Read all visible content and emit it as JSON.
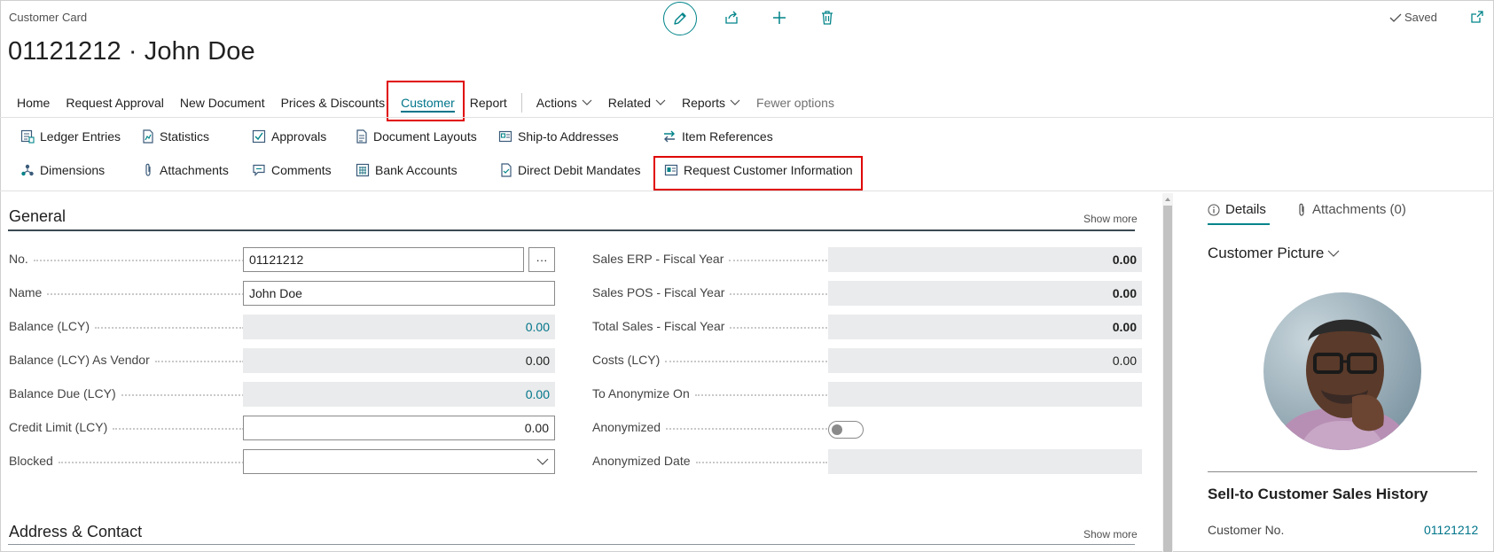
{
  "window": {
    "caption": "Customer Card",
    "title": "01121212 · John Doe",
    "status": "Saved"
  },
  "menu": {
    "items": [
      "Home",
      "Request Approval",
      "New Document",
      "Prices & Discounts",
      "Customer",
      "Report"
    ],
    "dropdowns": [
      "Actions",
      "Related",
      "Reports"
    ],
    "fewer_options": "Fewer options"
  },
  "actions": {
    "ledger_entries": "Ledger Entries",
    "statistics": "Statistics",
    "approvals": "Approvals",
    "document_layouts": "Document Layouts",
    "ship_to_addresses": "Ship-to Addresses",
    "item_references": "Item References",
    "dimensions": "Dimensions",
    "attachments": "Attachments",
    "comments": "Comments",
    "bank_accounts": "Bank Accounts",
    "direct_debit_mandates": "Direct Debit Mandates",
    "request_customer_information": "Request Customer Information"
  },
  "general": {
    "title": "General",
    "show_more": "Show more",
    "left_fields": [
      {
        "label": "No.",
        "value": "01121212"
      },
      {
        "label": "Name",
        "value": "John Doe"
      },
      {
        "label": "Balance (LCY)",
        "value": "0.00"
      },
      {
        "label": "Balance (LCY) As Vendor",
        "value": "0.00"
      },
      {
        "label": "Balance Due (LCY)",
        "value": "0.00"
      },
      {
        "label": "Credit Limit (LCY)",
        "value": "0.00"
      },
      {
        "label": "Blocked",
        "value": ""
      }
    ],
    "right_fields": [
      {
        "label": "Sales ERP - Fiscal Year",
        "value": "0.00"
      },
      {
        "label": "Sales POS - Fiscal Year",
        "value": "0.00"
      },
      {
        "label": "Total Sales - Fiscal Year",
        "value": "0.00"
      },
      {
        "label": "Costs (LCY)",
        "value": "0.00"
      },
      {
        "label": "To Anonymize On",
        "value": ""
      },
      {
        "label": "Anonymized",
        "value": "off"
      },
      {
        "label": "Anonymized Date",
        "value": ""
      }
    ],
    "more_button": "···"
  },
  "address": {
    "title": "Address & Contact",
    "show_more": "Show more"
  },
  "factbox": {
    "tab_details": "Details",
    "tab_attachments": "Attachments (0)",
    "customer_picture": "Customer Picture",
    "sales_history_title": "Sell-to Customer Sales History",
    "customer_no_label": "Customer No.",
    "customer_no_value": "01121212"
  },
  "colors": {
    "accent": "#008489",
    "highlight": "#e00000",
    "readonly_bg": "#eaebec"
  }
}
